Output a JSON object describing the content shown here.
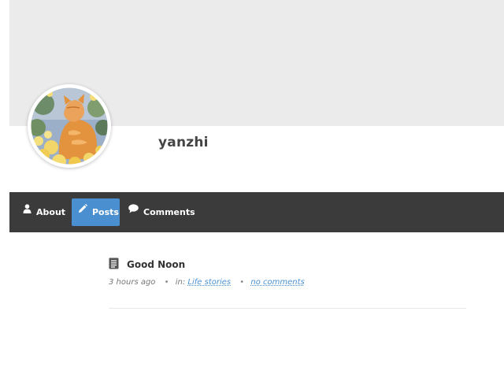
{
  "profile": {
    "username": "yanzhi"
  },
  "nav": {
    "items": [
      {
        "label": "About",
        "icon": "user-icon"
      },
      {
        "label": "Posts",
        "icon": "pencil-icon",
        "active": true
      },
      {
        "label": "Comments",
        "icon": "speech-bubble-icon"
      }
    ]
  },
  "post": {
    "icon": "document-icon",
    "title": "Good Noon",
    "time": "3 hours ago",
    "in_prefix": "in:",
    "category": "Life stories",
    "comments": "no comments"
  },
  "colors": {
    "cover": "#ebebeb",
    "navbar": "#3b3b3b",
    "accent": "#4a90d0"
  }
}
